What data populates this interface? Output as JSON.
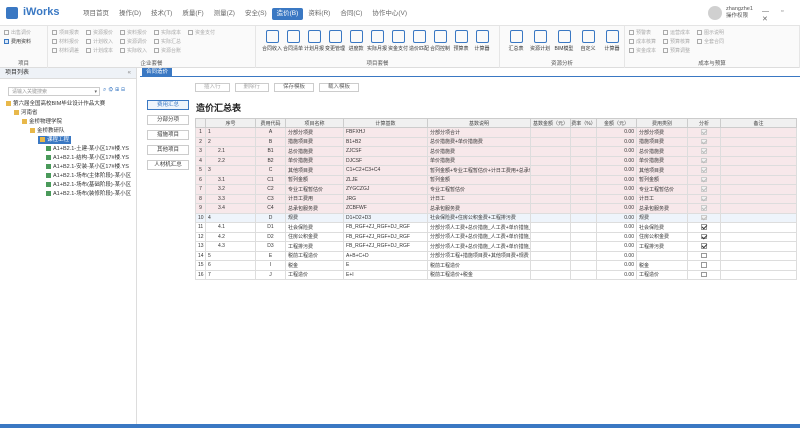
{
  "app": {
    "brand": "iWorks",
    "user_name": "zhangzhe1",
    "user_role": "操作权限",
    "window_controls": "— ▫ ✕"
  },
  "menu": [
    "项目首页",
    "操作(D)",
    "技术(T)",
    "质量(F)",
    "测量(Z)",
    "安全(S)",
    "造价(B)",
    "资料(R)",
    "合同(C)",
    "协作中心(V)"
  ],
  "menu_active_index": 6,
  "ribbon": {
    "groups": [
      {
        "label": "项目",
        "buttons": [
          {
            "label": "出售调价",
            "enabled": false
          },
          {
            "label": "费用资料",
            "enabled": true
          }
        ]
      },
      {
        "label": "企业套餐",
        "buttons": [
          {
            "label": "项目报表",
            "enabled": false
          },
          {
            "label": "材料报价",
            "enabled": false
          },
          {
            "label": "材料调差",
            "enabled": false
          },
          {
            "label": "资源报价",
            "enabled": false
          },
          {
            "label": "计划收入",
            "enabled": false
          },
          {
            "label": "计划成本",
            "enabled": false
          },
          {
            "label": "资料报价",
            "enabled": false
          },
          {
            "label": "资源调价",
            "enabled": false
          },
          {
            "label": "实际收入",
            "enabled": false
          },
          {
            "label": "实际成本",
            "enabled": false
          },
          {
            "label": "实际汇总",
            "enabled": false
          },
          {
            "label": "资源台账",
            "enabled": false
          },
          {
            "label": "资金支付",
            "enabled": false
          }
        ]
      },
      {
        "label": "项目套餐",
        "buttons": [
          {
            "label": "合同收入",
            "enabled": true
          },
          {
            "label": "合同清单",
            "enabled": true
          },
          {
            "label": "计划月报",
            "enabled": true
          },
          {
            "label": "变更管理",
            "enabled": true
          },
          {
            "label": "进度款",
            "enabled": true
          },
          {
            "label": "实际月报",
            "enabled": true
          },
          {
            "label": "资金支付",
            "enabled": true
          },
          {
            "label": "造价匹配",
            "enabled": true
          },
          {
            "label": "合同控制",
            "enabled": true
          },
          {
            "label": "预算表",
            "enabled": true
          },
          {
            "label": "计算器",
            "enabled": true
          }
        ]
      },
      {
        "label": "资源分析",
        "buttons": [
          {
            "label": "汇总表",
            "enabled": true
          },
          {
            "label": "资源计划",
            "enabled": true
          },
          {
            "label": "BIM模型",
            "enabled": true
          },
          {
            "label": "自定义",
            "enabled": true
          },
          {
            "label": "计算器",
            "enabled": true
          }
        ]
      },
      {
        "label": "成本与预算",
        "buttons": [
          {
            "label": "预警表",
            "enabled": false
          },
          {
            "label": "成本核算",
            "enabled": false
          },
          {
            "label": "资金成本",
            "enabled": false
          },
          {
            "label": "运营成本",
            "enabled": false
          },
          {
            "label": "预算核算",
            "enabled": false
          },
          {
            "label": "预算调整",
            "enabled": false
          },
          {
            "label": "图示说明",
            "enabled": false
          },
          {
            "label": "全套合同",
            "enabled": false
          }
        ]
      }
    ]
  },
  "left_panel": {
    "title": "项目列表",
    "search_placeholder": "请输入关键搜索",
    "tree": [
      {
        "label": "第六届全国高校BIM毕业设计作品大赛",
        "level": 0,
        "kind": "folder"
      },
      {
        "label": "河南省",
        "level": 1,
        "kind": "folder"
      },
      {
        "label": "金桥物理学院",
        "level": 2,
        "kind": "folder"
      },
      {
        "label": "金桥教研队",
        "level": 3,
        "kind": "folder"
      },
      {
        "label": "课程工程",
        "level": 4,
        "kind": "folder",
        "selected": true
      },
      {
        "label": "A1+B2.1-土建-某小区17#楼.YS",
        "level": 5,
        "kind": "file"
      },
      {
        "label": "A1+B2.1-结构-某小区17#楼.YS",
        "level": 5,
        "kind": "file"
      },
      {
        "label": "A1+B2.1-安装-某小区17#楼.YS",
        "level": 5,
        "kind": "file"
      },
      {
        "label": "A1+B2.1-场布(主体阶段)-某小区",
        "level": 5,
        "kind": "file"
      },
      {
        "label": "A1+B2.1-场布(基础阶段)-某小区",
        "level": 5,
        "kind": "file"
      },
      {
        "label": "A1+B2.1-场布(装修阶段)-某小区",
        "level": 5,
        "kind": "file"
      }
    ]
  },
  "content": {
    "tab": "合同造价",
    "actions": [
      {
        "label": "插入行",
        "enabled": false
      },
      {
        "label": "删除行",
        "enabled": false
      },
      {
        "label": "保存模板",
        "enabled": true
      },
      {
        "label": "载入模板",
        "enabled": true
      }
    ],
    "side_buttons": [
      {
        "label": "费用汇总",
        "active": true
      },
      {
        "label": "分部分项",
        "active": false
      },
      {
        "label": "措施项目",
        "active": false
      },
      {
        "label": "其他项目",
        "active": false
      },
      {
        "label": "人材机汇总",
        "active": false
      }
    ],
    "title": "造价汇总表",
    "columns": [
      "序号",
      "费用代码",
      "项目名称",
      "计算基数",
      "基数说明",
      "基数金额（元）",
      "费率（%）",
      "金额（元）",
      "费用类别",
      "分析",
      "备注"
    ],
    "rows": [
      {
        "n": "1",
        "seq": "1",
        "code": "A",
        "name": "分部分项费",
        "base": "FBFXHJ",
        "desc": "分部分项合计",
        "base_amt": "",
        "rate": "",
        "amt": "0.00",
        "cat": "分部分项费",
        "check": true,
        "disabled": true,
        "tone": "pink",
        "indent": 0
      },
      {
        "n": "2",
        "seq": "2",
        "code": "B",
        "name": "措施项目费",
        "base": "B1+B2",
        "desc": "总价措施费+单价措施费",
        "base_amt": "",
        "rate": "",
        "amt": "0.00",
        "cat": "措施项目费",
        "check": true,
        "disabled": true,
        "tone": "pink",
        "indent": 0
      },
      {
        "n": "3",
        "seq": "2.1",
        "code": "B1",
        "name": "总价措施费",
        "base": "ZJCSF",
        "desc": "总价措施费",
        "base_amt": "",
        "rate": "",
        "amt": "0.00",
        "cat": "总价措施费",
        "check": true,
        "disabled": true,
        "tone": "pink",
        "indent": 1
      },
      {
        "n": "4",
        "seq": "2.2",
        "code": "B2",
        "name": "单价措施费",
        "base": "DJCSF",
        "desc": "单价措施费",
        "base_amt": "",
        "rate": "",
        "amt": "0.00",
        "cat": "单价措施费",
        "check": true,
        "disabled": true,
        "tone": "pink",
        "indent": 1
      },
      {
        "n": "5",
        "seq": "3",
        "code": "C",
        "name": "其他项目费",
        "base": "C1+C2+C3+C4",
        "desc": "暂列金额+专业工程暂估价+计日工费用+总承包服务费",
        "base_amt": "",
        "rate": "",
        "amt": "0.00",
        "cat": "其他项目费",
        "check": true,
        "disabled": true,
        "tone": "pink",
        "indent": 0
      },
      {
        "n": "6",
        "seq": "3.1",
        "code": "C1",
        "name": "暂列金额",
        "base": "ZLJE",
        "desc": "暂列金额",
        "base_amt": "",
        "rate": "",
        "amt": "0.00",
        "cat": "暂列金额",
        "check": true,
        "disabled": true,
        "tone": "pink",
        "indent": 1
      },
      {
        "n": "7",
        "seq": "3.2",
        "code": "C2",
        "name": "专业工程暂估价",
        "base": "ZYGCZGJ",
        "desc": "专业工程暂估价",
        "base_amt": "",
        "rate": "",
        "amt": "0.00",
        "cat": "专业工程暂估价",
        "check": true,
        "disabled": true,
        "tone": "pink",
        "indent": 1
      },
      {
        "n": "8",
        "seq": "3.3",
        "code": "C3",
        "name": "计日工费用",
        "base": "JRG",
        "desc": "计日工",
        "base_amt": "",
        "rate": "",
        "amt": "0.00",
        "cat": "计日工",
        "check": true,
        "disabled": true,
        "tone": "pink",
        "indent": 1
      },
      {
        "n": "9",
        "seq": "3.4",
        "code": "C4",
        "name": "总承包服务费",
        "base": "ZCBFWF",
        "desc": "总承包服务费",
        "base_amt": "",
        "rate": "",
        "amt": "0.00",
        "cat": "总承包服务费",
        "check": true,
        "disabled": true,
        "tone": "pink",
        "indent": 1
      },
      {
        "n": "10",
        "seq": "4",
        "code": "D",
        "name": "规费",
        "base": "D1+D2+D3",
        "desc": "社会保险费+住房公积金费+工程排污费",
        "base_amt": "",
        "rate": "",
        "amt": "0.00",
        "cat": "规费",
        "check": true,
        "disabled": true,
        "tone": "blue",
        "indent": 0
      },
      {
        "n": "11",
        "seq": "4.1",
        "code": "D1",
        "name": "社会保险费",
        "base": "FB_RGF+ZJ_RGF+DJ_RGF",
        "desc": "分部分项人工费+总价措施_人工费+单价措施_人工费",
        "base_amt": "",
        "rate": "",
        "amt": "0.00",
        "cat": "社会保险费",
        "check": true,
        "disabled": false,
        "tone": "",
        "indent": 1
      },
      {
        "n": "12",
        "seq": "4.2",
        "code": "D2",
        "name": "住房公积金费",
        "base": "FB_RGF+ZJ_RGF+DJ_RGF",
        "desc": "分部分项人工费+总价措施_人工费+单价措施_人工费",
        "base_amt": "",
        "rate": "",
        "amt": "0.00",
        "cat": "住房公积金费",
        "check": true,
        "disabled": false,
        "tone": "",
        "indent": 1
      },
      {
        "n": "13",
        "seq": "4.3",
        "code": "D3",
        "name": "工程排污费",
        "base": "FB_RGF+ZJ_RGF+DJ_RGF",
        "desc": "分部分项人工费+总价措施_人工费+单价措施_人工费",
        "base_amt": "",
        "rate": "",
        "amt": "0.00",
        "cat": "工程排污费",
        "check": true,
        "disabled": false,
        "tone": "",
        "indent": 1
      },
      {
        "n": "14",
        "seq": "5",
        "code": "E",
        "name": "税前工程造价",
        "base": "A+B+C+D",
        "desc": "分部分项工程+措施项目费+其他项目费+规费",
        "base_amt": "",
        "rate": "",
        "amt": "0.00",
        "cat": "",
        "check": false,
        "disabled": false,
        "tone": "",
        "indent": 0
      },
      {
        "n": "15",
        "seq": "6",
        "code": "I",
        "name": "税金",
        "base": "E",
        "desc": "税前工程造价",
        "base_amt": "",
        "rate": "",
        "amt": "0.00",
        "cat": "税金",
        "check": false,
        "disabled": false,
        "tone": "",
        "indent": 0
      },
      {
        "n": "16",
        "seq": "7",
        "code": "J",
        "name": "工程造价",
        "base": "E+I",
        "desc": "税前工程造价+税金",
        "base_amt": "",
        "rate": "",
        "amt": "0.00",
        "cat": "工程造价",
        "check": false,
        "disabled": false,
        "tone": "",
        "indent": 0
      }
    ]
  },
  "colors": {
    "accent": "#3a78c3",
    "pink_row": "#f7e8ea",
    "blue_row": "#eef4fb"
  }
}
